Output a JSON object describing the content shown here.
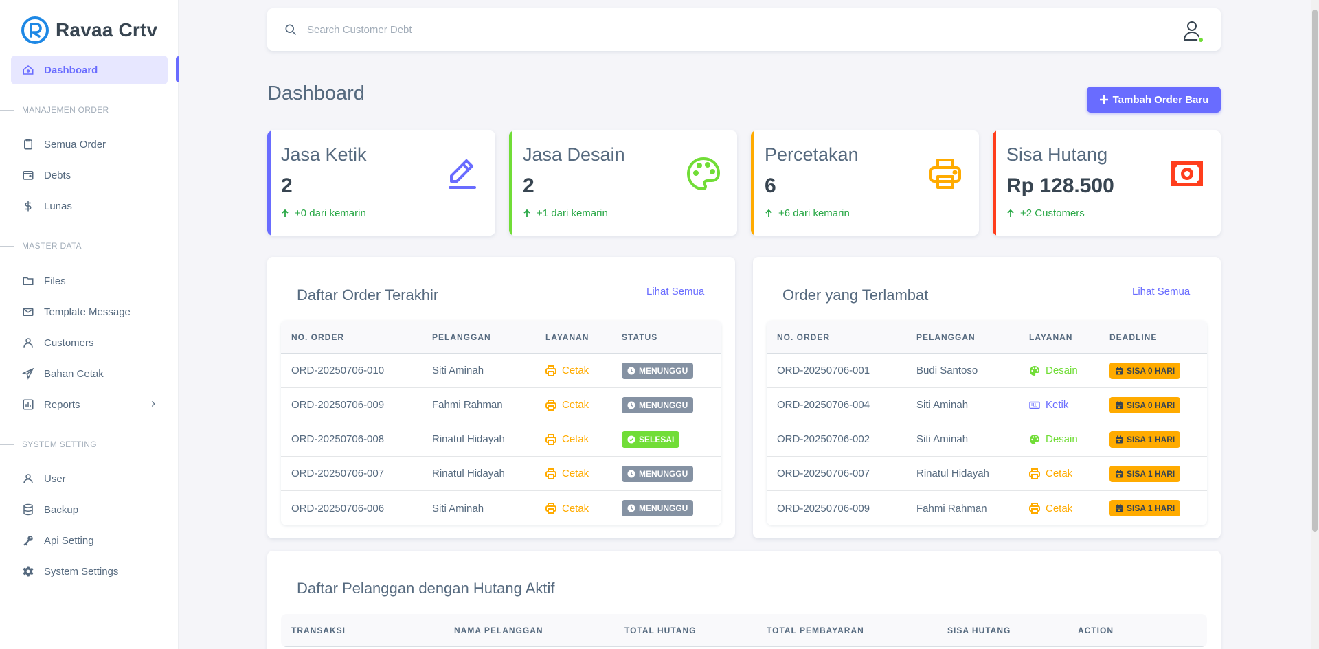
{
  "brand": {
    "name": "Ravaa Crtv"
  },
  "sidebar": {
    "dashboard": "Dashboard",
    "section_order": "MANAJEMEN ORDER",
    "semua_order": "Semua Order",
    "debts": "Debts",
    "lunas": "Lunas",
    "section_master": "MASTER DATA",
    "files": "Files",
    "template_message": "Template Message",
    "customers": "Customers",
    "bahan_cetak": "Bahan Cetak",
    "reports": "Reports",
    "section_system": "SYSTEM SETTING",
    "user": "User",
    "backup": "Backup",
    "api_setting": "Api Setting",
    "system_settings": "System Settings"
  },
  "search": {
    "placeholder": "Search Customer Debt"
  },
  "page": {
    "title": "Dashboard",
    "add_button": "Tambah Order Baru"
  },
  "stats": [
    {
      "title": "Jasa Ketik",
      "value": "2",
      "sub": "+0 dari kemarin",
      "color": "#696cff",
      "icon": "pencil-icon"
    },
    {
      "title": "Jasa Desain",
      "value": "2",
      "sub": "+1 dari kemarin",
      "color": "#71dd37",
      "icon": "palette-icon"
    },
    {
      "title": "Percetakan",
      "value": "6",
      "sub": "+6 dari kemarin",
      "color": "#ffab00",
      "icon": "printer-icon"
    },
    {
      "title": "Sisa Hutang",
      "value": "Rp 128.500",
      "sub": "+2 Customers",
      "color": "#ff3e1d",
      "icon": "money-icon"
    }
  ],
  "recent_orders": {
    "title": "Daftar Order Terakhir",
    "link": "Lihat Semua",
    "headers": [
      "NO. ORDER",
      "PELANGGAN",
      "LAYANAN",
      "STATUS"
    ],
    "rows": [
      {
        "order": "ORD-20250706-010",
        "customer": "Siti Aminah",
        "service": "Cetak",
        "status": "MENUNGGU"
      },
      {
        "order": "ORD-20250706-009",
        "customer": "Fahmi Rahman",
        "service": "Cetak",
        "status": "MENUNGGU"
      },
      {
        "order": "ORD-20250706-008",
        "customer": "Rinatul Hidayah",
        "service": "Cetak",
        "status": "SELESAI"
      },
      {
        "order": "ORD-20250706-007",
        "customer": "Rinatul Hidayah",
        "service": "Cetak",
        "status": "MENUNGGU"
      },
      {
        "order": "ORD-20250706-006",
        "customer": "Siti Aminah",
        "service": "Cetak",
        "status": "MENUNGGU"
      }
    ]
  },
  "late_orders": {
    "title": "Order yang Terlambat",
    "link": "Lihat Semua",
    "headers": [
      "NO. ORDER",
      "PELANGGAN",
      "LAYANAN",
      "DEADLINE"
    ],
    "rows": [
      {
        "order": "ORD-20250706-001",
        "customer": "Budi Santoso",
        "service": "Desain",
        "deadline": "SISA 0 HARI"
      },
      {
        "order": "ORD-20250706-004",
        "customer": "Siti Aminah",
        "service": "Ketik",
        "deadline": "SISA 0 HARI"
      },
      {
        "order": "ORD-20250706-002",
        "customer": "Siti Aminah",
        "service": "Desain",
        "deadline": "SISA 1 HARI"
      },
      {
        "order": "ORD-20250706-007",
        "customer": "Rinatul Hidayah",
        "service": "Cetak",
        "deadline": "SISA 1 HARI"
      },
      {
        "order": "ORD-20250706-009",
        "customer": "Fahmi Rahman",
        "service": "Cetak",
        "deadline": "SISA 1 HARI"
      }
    ]
  },
  "debts": {
    "title": "Daftar Pelanggan dengan Hutang Aktif",
    "headers": [
      "TRANSAKSI",
      "NAMA PELANGGAN",
      "TOTAL HUTANG",
      "TOTAL PEMBAYARAN",
      "SISA HUTANG",
      "ACTION"
    ]
  },
  "colors": {
    "primary": "#696cff",
    "success": "#71dd37",
    "warning": "#ffab00",
    "danger": "#ff3e1d",
    "secondary": "#8592a3",
    "ketik": "#696cff"
  }
}
